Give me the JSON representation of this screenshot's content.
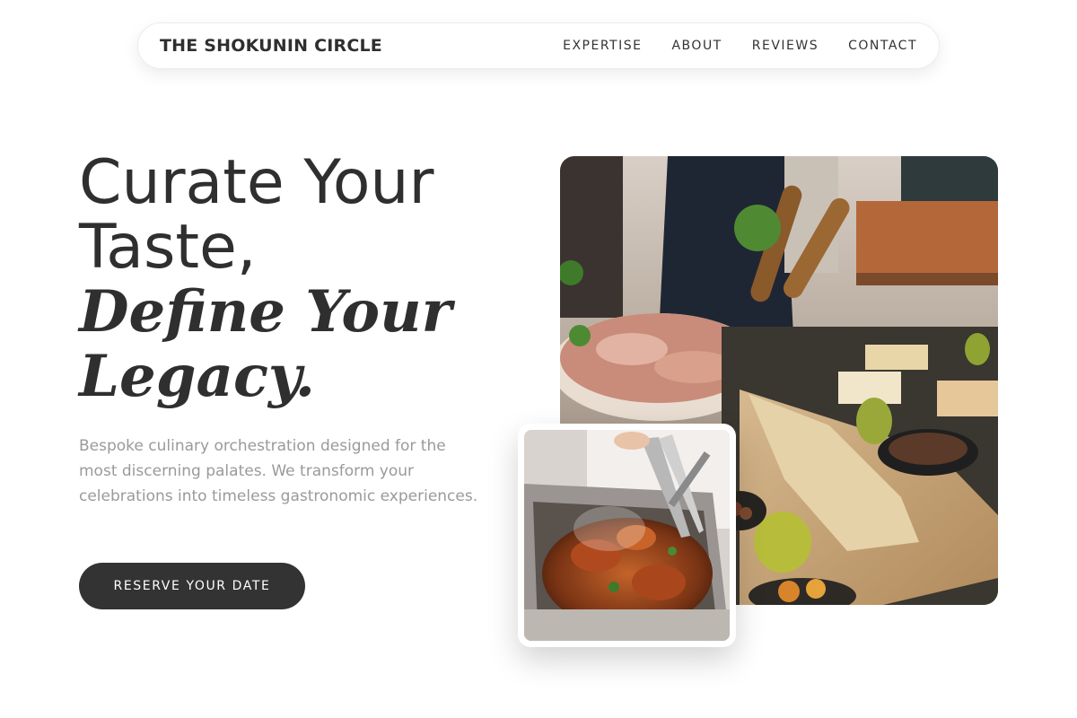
{
  "header": {
    "brand": "THE SHOKUNIN CIRCLE",
    "nav": [
      {
        "label": "EXPERTISE"
      },
      {
        "label": "ABOUT"
      },
      {
        "label": "REVIEWS"
      },
      {
        "label": "CONTACT"
      }
    ]
  },
  "hero": {
    "title_line1": "Curate Your",
    "title_line2": "Taste,",
    "title_italic_line1": "Define Your",
    "title_italic_line2": "Legacy.",
    "description": "Bespoke culinary orchestration designed for the most discerning palates. We transform your celebrations into timeless gastronomic experiences.",
    "cta_label": "RESERVE YOUR DATE"
  },
  "colors": {
    "text_dark": "#333333",
    "text_muted": "#9a9a9a",
    "button_bg": "#333333",
    "background": "#ffffff"
  }
}
